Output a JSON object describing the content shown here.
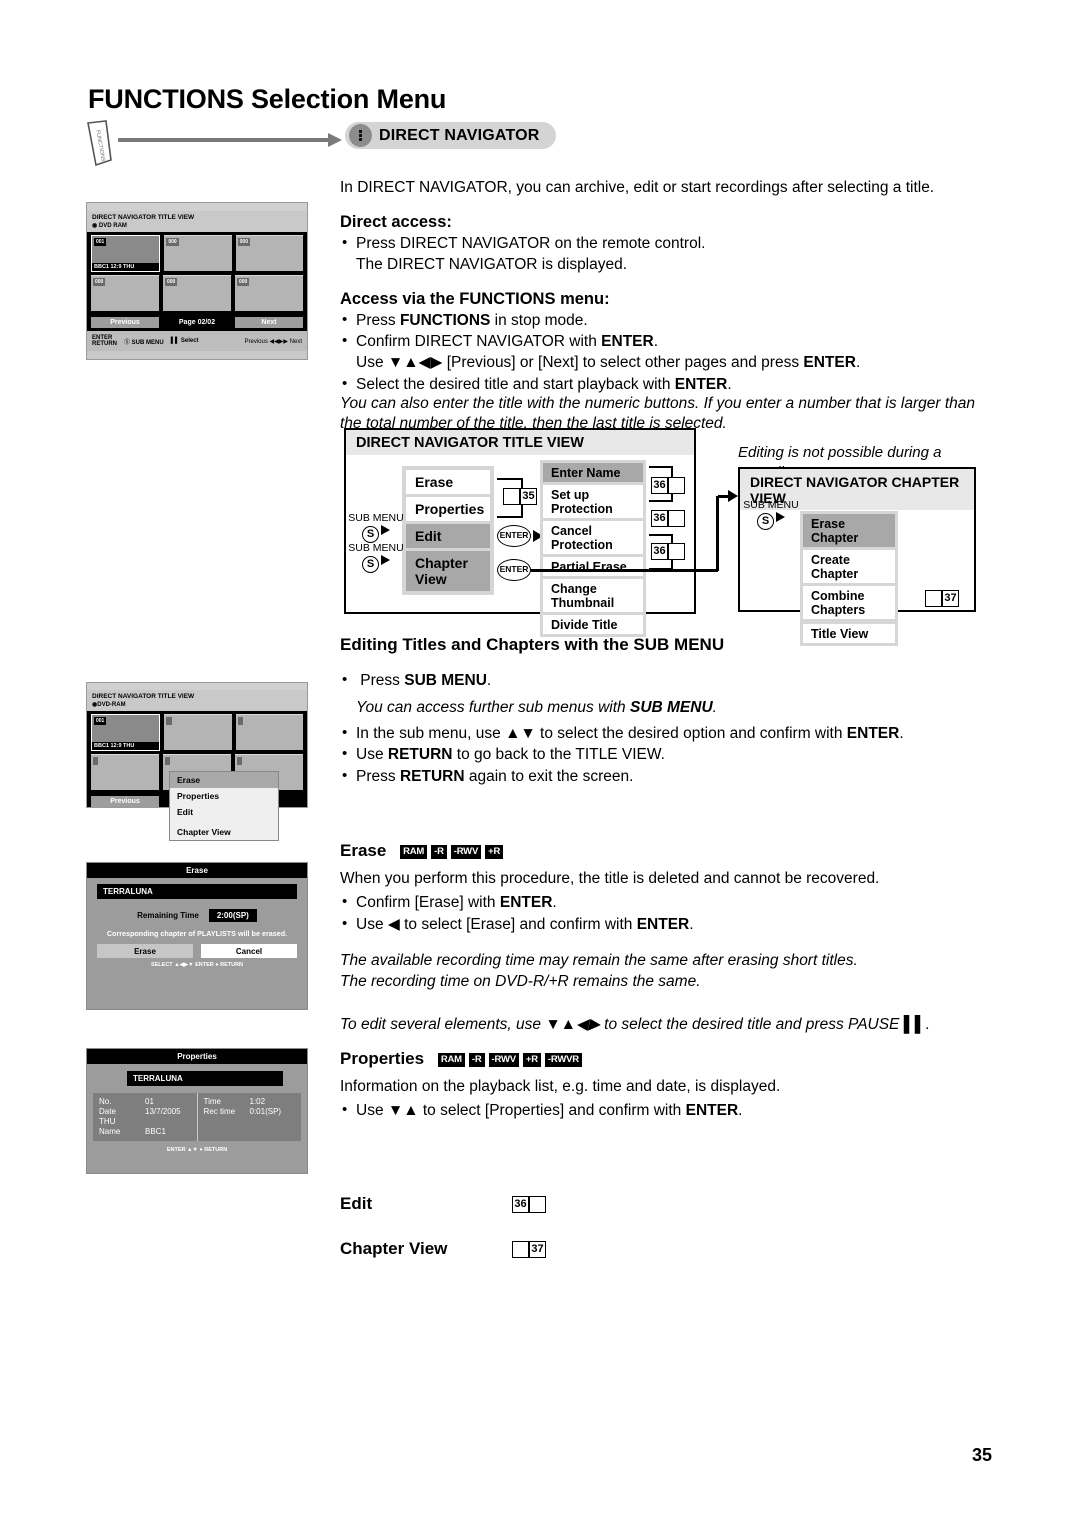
{
  "page": {
    "title": "FUNCTIONS Selection Menu",
    "number": "35",
    "functions_tab_label": "FUNCTIONS",
    "direct_navigator_pill": "DIRECT NAVIGATOR"
  },
  "intro": {
    "lead": "In DIRECT NAVIGATOR, you can archive, edit or start recordings after selecting a title.",
    "direct_access_heading": "Direct access:",
    "direct_access_items": [
      "Press DIRECT NAVIGATOR on the remote control.",
      "The DIRECT NAVIGATOR is displayed."
    ],
    "functions_heading": "Access via the FUNCTIONS menu:",
    "functions_items": [
      "Press FUNCTIONS in stop mode.",
      "Confirm DIRECT NAVIGATOR with ENTER.",
      "Use ▼▲◀▶ [Previous] or [Next] to select other pages and press ENTER.",
      "Select the desired title and start playback with ENTER."
    ],
    "note": "You can also enter the title with the numeric buttons. If you enter a number that is larger than the total number of the title, then the last title is selected.",
    "recording_note": "Editing is not possible during a recording."
  },
  "flow": {
    "title_view_header": "DIRECT NAVIGATOR  TITLE VIEW",
    "chapter_view_header": "DIRECT NAVIGATOR  CHAPTER VIEW",
    "sub_menu_label": "SUB MENU",
    "s_button": "S",
    "enter_label": "ENTER",
    "title_menu": [
      {
        "label": "Erase",
        "selected": false
      },
      {
        "label": "Properties",
        "selected": false
      },
      {
        "label": "Edit",
        "selected": true
      },
      {
        "label": "Chapter View",
        "selected": true
      }
    ],
    "edit_submenu": [
      {
        "label": "Enter Name",
        "selected": true
      },
      {
        "label": "Set up Protection",
        "selected": false
      },
      {
        "label": "Cancel Protection",
        "selected": false
      },
      {
        "label": "Partial Erase",
        "selected": false
      },
      {
        "label": "Change Thumbnail",
        "selected": false
      },
      {
        "label": "Divide Title",
        "selected": false
      }
    ],
    "chapter_menu": [
      {
        "label": "Erase Chapter",
        "selected": true
      },
      {
        "label": "Create Chapter",
        "selected": false
      },
      {
        "label": "Combine Chapters",
        "selected": false
      },
      {
        "label": "Title View",
        "selected": false
      }
    ],
    "page_refs": {
      "title_menu_ref": "35",
      "sub_ref_1": "36",
      "sub_ref_2": "36",
      "sub_ref_3": "36",
      "chapter_ref": "37"
    }
  },
  "sub_menu_section": {
    "heading": "Editing Titles and Chapters with the SUB MENU",
    "items": [
      "Press SUB MENU.",
      "In the sub menu, use ▲▼ to select the desired option and confirm with ENTER.",
      "Use RETURN to go back to the TITLE VIEW.",
      "Press RETURN again to exit the screen."
    ],
    "note": "You can access further sub menus with SUB MENU."
  },
  "erase_section": {
    "heading": "Erase",
    "badges": [
      "RAM",
      "-R",
      "-RWV",
      "+R"
    ],
    "lead": "When you perform this procedure, the title is deleted and cannot be recovered.",
    "items": [
      "Confirm [Erase] with ENTER.",
      "Use ◀ to select [Erase] and confirm with ENTER."
    ],
    "notes": [
      "The available recording time may remain the same after erasing short titles.",
      "The recording time on DVD-R/+R remains the same."
    ],
    "pause_note": "To edit several elements, use ▼▲◀▶ to select the desired title and press PAUSE"
  },
  "properties_section": {
    "heading": "Properties",
    "badges": [
      "RAM",
      "-R",
      "-RWV",
      "+R",
      "-RWVR"
    ],
    "lead": "Information on the playback list, e.g. time and date, is displayed.",
    "items": [
      "Use ▼▲ to select [Properties] and confirm with ENTER."
    ]
  },
  "edit_link": {
    "label": "Edit",
    "ref": "36"
  },
  "chapter_link": {
    "label": "Chapter View",
    "ref": "37"
  },
  "shot_title_view": {
    "header": "DIRECT NAVIGATOR TITLE VIEW",
    "disc": "DVD RAM",
    "thumb_num": "001",
    "thumb_caption": "BBC1  12:9 THU",
    "cell_num": "000",
    "nav_prev": "Previous",
    "nav_page": "Page 02/02",
    "nav_next": "Next",
    "foot_enter": "ENTER",
    "foot_return": "RETURN",
    "foot_submenu": "SUB MENU",
    "foot_select": "Select",
    "foot_s": "S",
    "foot_prev": "Previous",
    "foot_next": "Next"
  },
  "shot_sub_menu": {
    "header": "DIRECT NAVIGATOR TITLE VIEW",
    "disc": "DVD-RAM",
    "thumb_num": "001",
    "thumb_caption": "BBC1   12:9 THU",
    "nav_prev": "Previous",
    "popover_items": [
      {
        "label": "Erase",
        "selected": true
      },
      {
        "label": "Properties",
        "selected": false
      },
      {
        "label": "Edit",
        "selected": false
      },
      {
        "label": "Chapter View",
        "selected": false
      }
    ]
  },
  "shot_erase": {
    "title": "Erase",
    "name": "TERRALUNA",
    "remaining_label": "Remaining Time",
    "remaining_value": "2:00(SP)",
    "note": "Corresponding chapter of PLAYLISTS will be erased.",
    "btn_erase": "Erase",
    "btn_cancel": "Cancel",
    "hint_select": "SELECT",
    "hint_enter": "ENTER",
    "hint_return": "RETURN"
  },
  "shot_properties": {
    "title": "Properties",
    "name": "TERRALUNA",
    "rows_left": [
      {
        "key": "No.",
        "value": "01"
      },
      {
        "key": "Date",
        "value": "13/7/2005"
      },
      {
        "key": "THU",
        "value": ""
      },
      {
        "key": "Name",
        "value": "BBC1"
      }
    ],
    "rows_right": [
      {
        "key": "Time",
        "value": "1:02"
      },
      {
        "key": "Rec time",
        "value": "0:01(SP)"
      }
    ],
    "hint_enter": "ENTER",
    "hint_return": "RETURN"
  }
}
